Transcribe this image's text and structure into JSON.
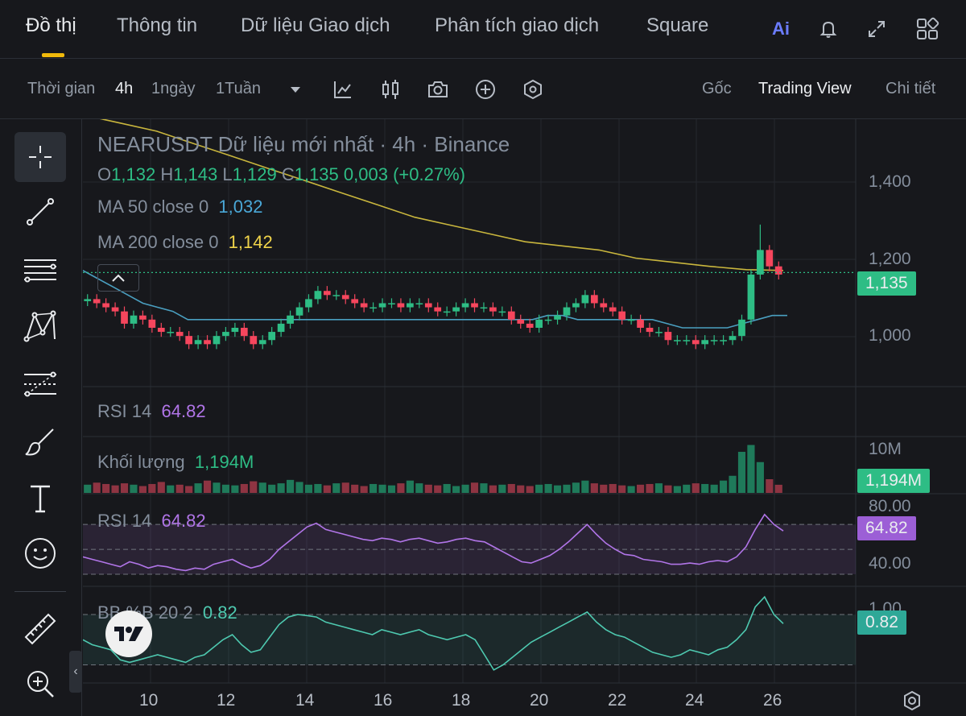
{
  "tabs": [
    {
      "label": "Đồ thị",
      "active": true
    },
    {
      "label": "Thông tin"
    },
    {
      "label": "Dữ liệu Giao dịch"
    },
    {
      "label": "Phân tích giao dịch"
    },
    {
      "label": "Square"
    }
  ],
  "top_icons": [
    "ai-icon",
    "bell-icon",
    "expand-icon",
    "grid-apps-icon"
  ],
  "ai_label": "Ai",
  "toolbar": {
    "time_label": "Thời gian",
    "intervals": [
      "4h",
      "1ngày",
      "1Tuần"
    ],
    "active_interval": "4h",
    "tool_icons": [
      "dropdown-caret-icon",
      "indicators-icon",
      "candle-type-icon",
      "camera-icon",
      "add-icon",
      "settings-hex-icon"
    ],
    "views": [
      "Gốc",
      "Trading View",
      "Chi tiết"
    ],
    "active_view": "Trading View"
  },
  "left_tools": [
    "crosshair-icon",
    "trendline-icon",
    "fib-lines-icon",
    "pattern-icon",
    "measure-lines-icon",
    "brush-icon",
    "text-icon",
    "emoji-icon",
    "ruler-icon",
    "zoom-in-icon"
  ],
  "legend": {
    "title": "NEARUSDT Dữ liệu mới nhất · 4h · Binance",
    "o_label": "O",
    "o_value": "1,132",
    "h_label": "H",
    "h_value": "1,143",
    "l_label": "L",
    "l_value": "1,129",
    "c_label": "C",
    "c_value": "1,135",
    "change": "0,003 (+0.27%)",
    "ma50_label": "MA 50 close 0",
    "ma50_value": "1,032",
    "ma200_label": "MA 200 close 0",
    "ma200_value": "1,142",
    "rsi_label": "RSI 14",
    "rsi_value": "64.82",
    "vol_label": "Khối lượng",
    "vol_value": "1,194M",
    "rsi2_label": "RSI 14",
    "rsi2_value": "64.82",
    "bb_label": "BB %B 20 2",
    "bb_value": "0.82"
  },
  "price_axis": [
    "1,400",
    "1,200",
    "1,000"
  ],
  "price_badge": "1,135",
  "volume_axis": "10M",
  "volume_badge": "1,194M",
  "rsi_axis": [
    "80.00",
    "40.00"
  ],
  "rsi_badge": "64.82",
  "bb_axis_partial": "1.00",
  "bb_badge": "0.82",
  "x_axis": [
    "10",
    "12",
    "14",
    "16",
    "18",
    "20",
    "22",
    "24",
    "26"
  ],
  "colors": {
    "up": "#2ebd85",
    "down": "#f6465d",
    "ma50": "#4a9fc0",
    "ma200": "#c9b63d",
    "rsi": "#b175e8",
    "bb": "#4ec9b0",
    "price_badge": "#2ebd85",
    "rsi_badge": "#9c5fd6",
    "bb_badge": "#2ea897"
  },
  "chart_data": {
    "type": "candlestick",
    "title": "NEARUSDT Dữ liệu mới nhất · 4h · Binance",
    "x_ticks": [
      "10",
      "12",
      "14",
      "16",
      "18",
      "20",
      "22",
      "24",
      "26"
    ],
    "y_ticks": [
      "1,400",
      "1,200",
      "1,000"
    ],
    "ylim": [
      0.88,
      1.47
    ],
    "last_price": 1.135,
    "close_series": [
      1.07,
      1.06,
      1.05,
      1.04,
      1.01,
      1.03,
      1.02,
      1.0,
      0.99,
      0.99,
      0.98,
      0.96,
      0.97,
      0.96,
      0.98,
      0.99,
      1.0,
      0.98,
      0.96,
      0.97,
      0.99,
      1.01,
      1.03,
      1.05,
      1.07,
      1.09,
      1.08,
      1.08,
      1.07,
      1.06,
      1.05,
      1.05,
      1.06,
      1.06,
      1.05,
      1.06,
      1.06,
      1.05,
      1.04,
      1.04,
      1.05,
      1.06,
      1.05,
      1.05,
      1.04,
      1.04,
      1.02,
      1.01,
      1.0,
      1.02,
      1.02,
      1.03,
      1.05,
      1.06,
      1.08,
      1.06,
      1.05,
      1.04,
      1.02,
      1.02,
      1.0,
      0.99,
      0.99,
      0.97,
      0.97,
      0.97,
      0.96,
      0.97,
      0.97,
      0.97,
      0.98,
      1.02,
      1.13,
      1.19,
      1.15,
      1.13
    ],
    "ma50_series": [
      1.14,
      1.12,
      1.1,
      1.08,
      1.06,
      1.05,
      1.04,
      1.02,
      1.02,
      1.02,
      1.02,
      1.02,
      1.02,
      1.02,
      1.02,
      1.02,
      1.02,
      1.02,
      1.02,
      1.02,
      1.02,
      1.02,
      1.02,
      1.02,
      1.02,
      1.02,
      1.02,
      1.02,
      1.02,
      1.02,
      1.02,
      1.03,
      1.03,
      1.02,
      1.02,
      1.02,
      1.02,
      1.02,
      1.02,
      1.01,
      1.0,
      1.0,
      1.0,
      1.0,
      1.01,
      1.02,
      1.03,
      1.03
    ],
    "ma200_series": [
      1.52,
      1.5,
      1.48,
      1.45,
      1.42,
      1.39,
      1.36,
      1.33,
      1.3,
      1.27,
      1.25,
      1.23,
      1.21,
      1.2,
      1.19,
      1.17,
      1.16,
      1.15,
      1.142,
      1.14
    ],
    "volume_series": [
      1.2,
      1.5,
      1.3,
      1.1,
      1.4,
      1.2,
      1.0,
      1.3,
      1.6,
      1.1,
      1.2,
      1.0,
      1.4,
      1.8,
      1.5,
      1.2,
      1.1,
      1.3,
      1.7,
      1.5,
      1.2,
      1.4,
      1.9,
      1.6,
      1.2,
      1.3,
      1.1,
      1.4,
      1.5,
      1.2,
      1.0,
      1.3,
      1.2,
      1.1,
      1.4,
      1.8,
      1.4,
      1.2,
      1.1,
      1.3,
      1.0,
      1.2,
      1.5,
      1.4,
      1.1,
      1.2,
      1.3,
      1.1,
      1.0,
      1.2,
      1.3,
      1.1,
      1.2,
      1.5,
      1.8,
      1.4,
      1.2,
      1.3,
      1.1,
      1.0,
      1.2,
      1.3,
      1.4,
      1.1,
      1.0,
      1.2,
      1.4,
      1.3,
      1.2,
      1.8,
      2.5,
      6.0,
      7.0,
      4.5,
      2.0,
      1.19
    ],
    "rsi_series": [
      44,
      42,
      40,
      38,
      36,
      40,
      38,
      35,
      37,
      36,
      34,
      33,
      35,
      34,
      38,
      40,
      42,
      38,
      35,
      37,
      42,
      50,
      56,
      62,
      68,
      71,
      66,
      64,
      62,
      60,
      58,
      57,
      59,
      58,
      56,
      58,
      59,
      57,
      55,
      56,
      58,
      59,
      57,
      56,
      52,
      48,
      44,
      40,
      39,
      42,
      45,
      50,
      56,
      63,
      70,
      62,
      55,
      50,
      46,
      45,
      42,
      41,
      40,
      38,
      38,
      39,
      38,
      40,
      41,
      40,
      44,
      52,
      66,
      78,
      70,
      64.82
    ],
    "bb_series": [
      0.5,
      0.4,
      0.35,
      0.3,
      0.1,
      0.05,
      0.1,
      0.15,
      0.2,
      0.15,
      0.1,
      0.05,
      0.15,
      0.2,
      0.35,
      0.5,
      0.6,
      0.4,
      0.25,
      0.3,
      0.55,
      0.8,
      0.95,
      1.0,
      0.98,
      0.95,
      0.85,
      0.8,
      0.75,
      0.7,
      0.65,
      0.6,
      0.7,
      0.65,
      0.6,
      0.65,
      0.7,
      0.6,
      0.55,
      0.5,
      0.55,
      0.6,
      0.5,
      0.2,
      -0.1,
      0.0,
      0.15,
      0.3,
      0.45,
      0.55,
      0.65,
      0.75,
      0.85,
      0.95,
      1.05,
      0.85,
      0.7,
      0.6,
      0.55,
      0.45,
      0.35,
      0.25,
      0.2,
      0.15,
      0.2,
      0.3,
      0.25,
      0.2,
      0.3,
      0.35,
      0.5,
      0.7,
      1.15,
      1.35,
      1.0,
      0.82
    ],
    "rsi_badge_value": 64.82,
    "bb_badge_value": 0.82,
    "volume_badge_value": "1,194M"
  }
}
